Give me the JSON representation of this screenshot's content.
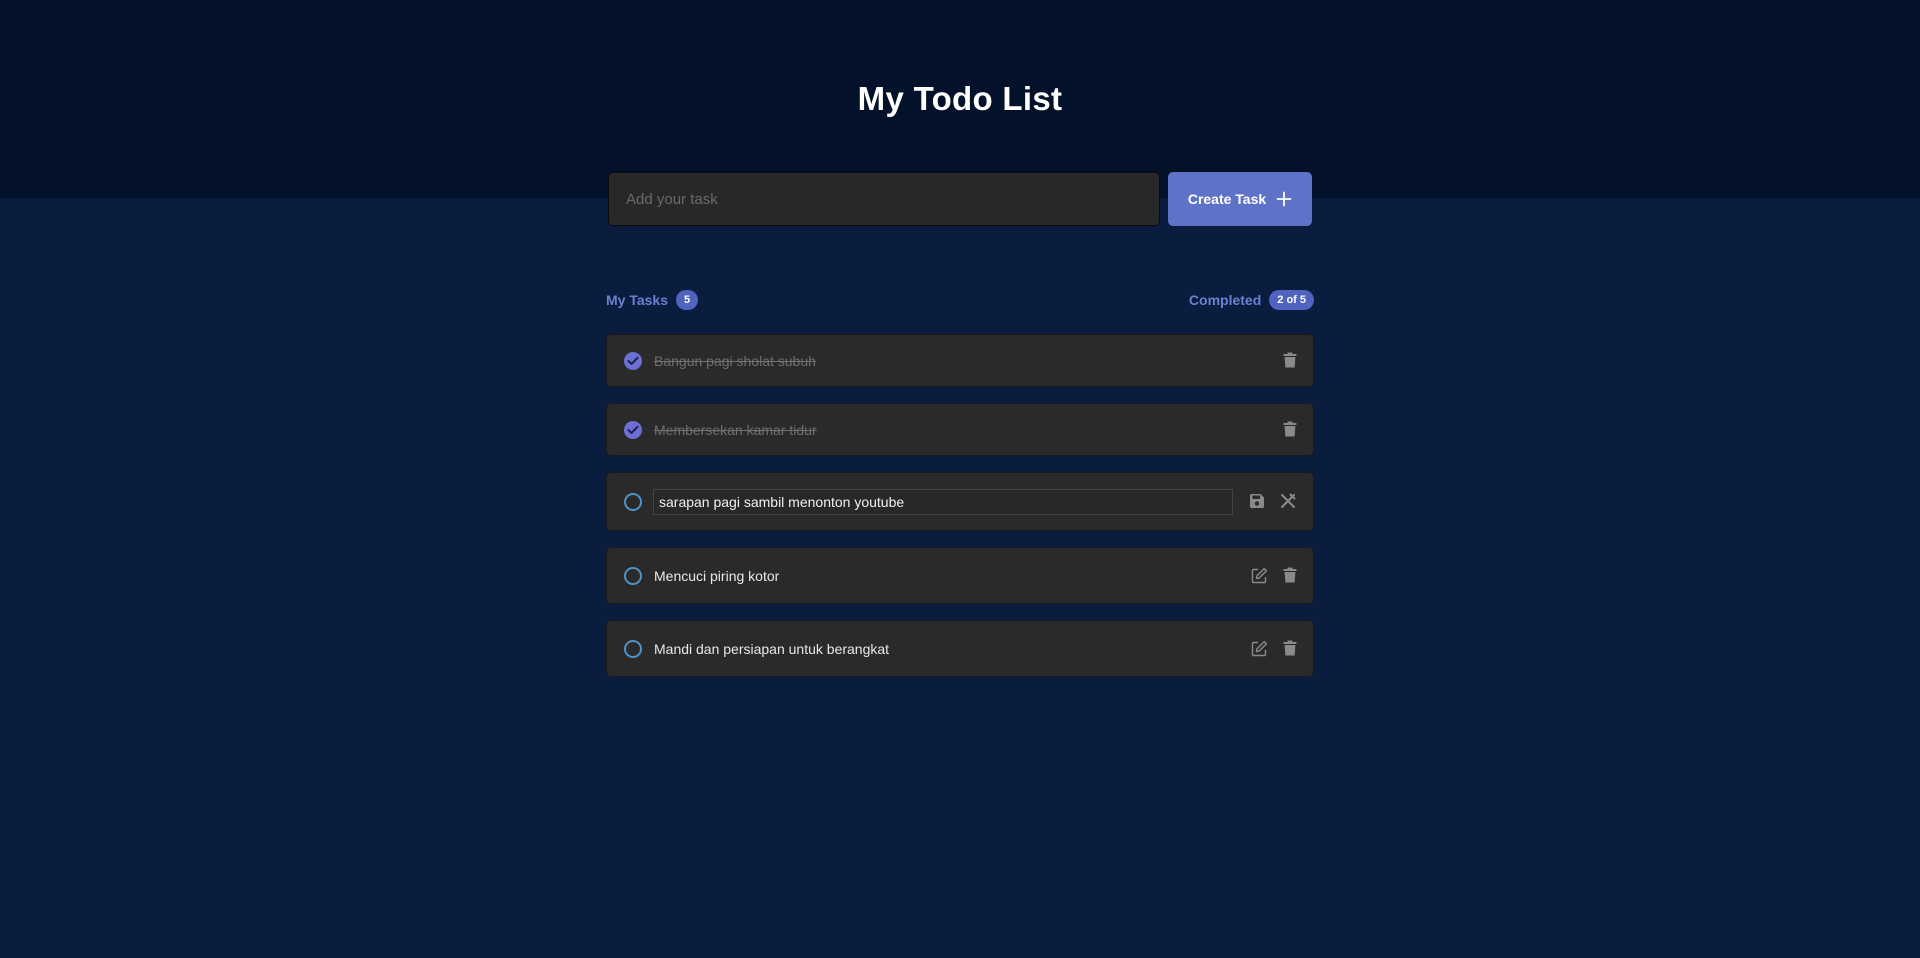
{
  "app": {
    "title": "My Todo List"
  },
  "add_form": {
    "placeholder": "Add your task",
    "value": "",
    "create_label": "Create Task"
  },
  "stats": {
    "tasks_label": "My Tasks",
    "tasks_count": "5",
    "completed_label": "Completed",
    "completed_count": "2 of 5"
  },
  "tasks": [
    {
      "text": "Bangun pagi sholat subuh",
      "completed": true,
      "editing": false
    },
    {
      "text": "Membersekan kamar tidur",
      "completed": true,
      "editing": false
    },
    {
      "text": "sarapan pagi sambil menonton youtube",
      "completed": false,
      "editing": true
    },
    {
      "text": "Mencuci piring kotor",
      "completed": false,
      "editing": false
    },
    {
      "text": "Mandi dan persiapan untuk berangkat",
      "completed": false,
      "editing": false
    }
  ],
  "colors": {
    "background": "#0a1d3f",
    "header": "#04112a",
    "accent": "#5e73c7",
    "badge": "#4f63bf",
    "check_done": "#6c6fd4",
    "check_open": "#4e93c7",
    "card": "#2a2a2a"
  },
  "icons": {
    "check": "checkmark-icon",
    "trash": "trash-icon",
    "edit": "edit-icon",
    "save": "save-icon",
    "cancel": "cancel-edit-icon",
    "plus": "plus-icon"
  }
}
